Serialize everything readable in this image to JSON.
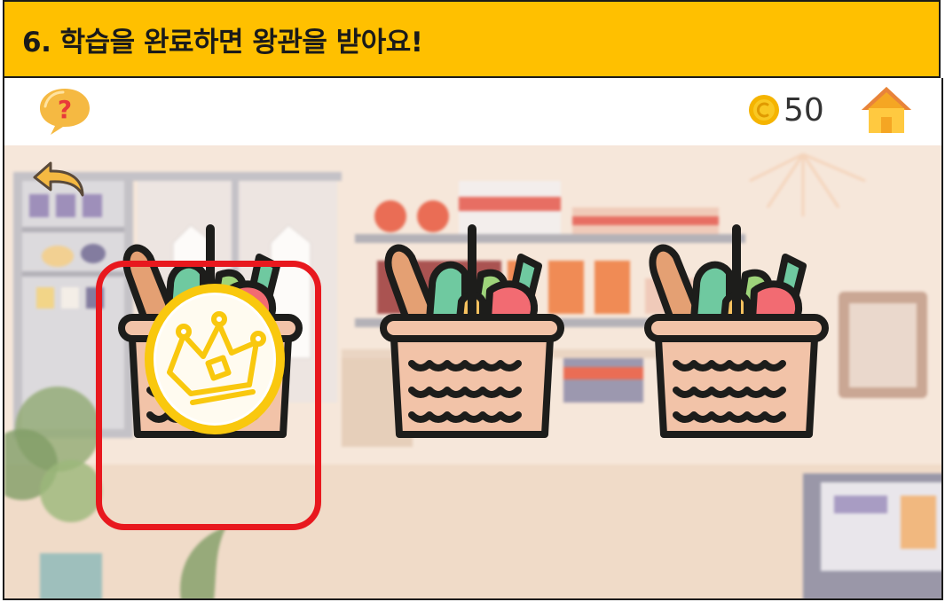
{
  "banner": {
    "title": "6. 학습을 완료하면 왕관을 받아요!"
  },
  "header": {
    "coin_count": "50"
  },
  "icons": {
    "help": "question-speech-bubble-icon",
    "coin": "coin-icon",
    "home": "home-icon",
    "back": "back-arrow-icon",
    "crown": "crown-badge-icon"
  },
  "baskets": [
    {
      "name": "basket-1",
      "completed": true,
      "highlighted": true
    },
    {
      "name": "basket-2",
      "completed": false,
      "highlighted": false
    },
    {
      "name": "basket-3",
      "completed": false,
      "highlighted": false
    }
  ],
  "colors": {
    "banner": "#FFC000",
    "highlight": "#E8181E",
    "badge": "#F9C80E",
    "home": "#F5A623"
  }
}
